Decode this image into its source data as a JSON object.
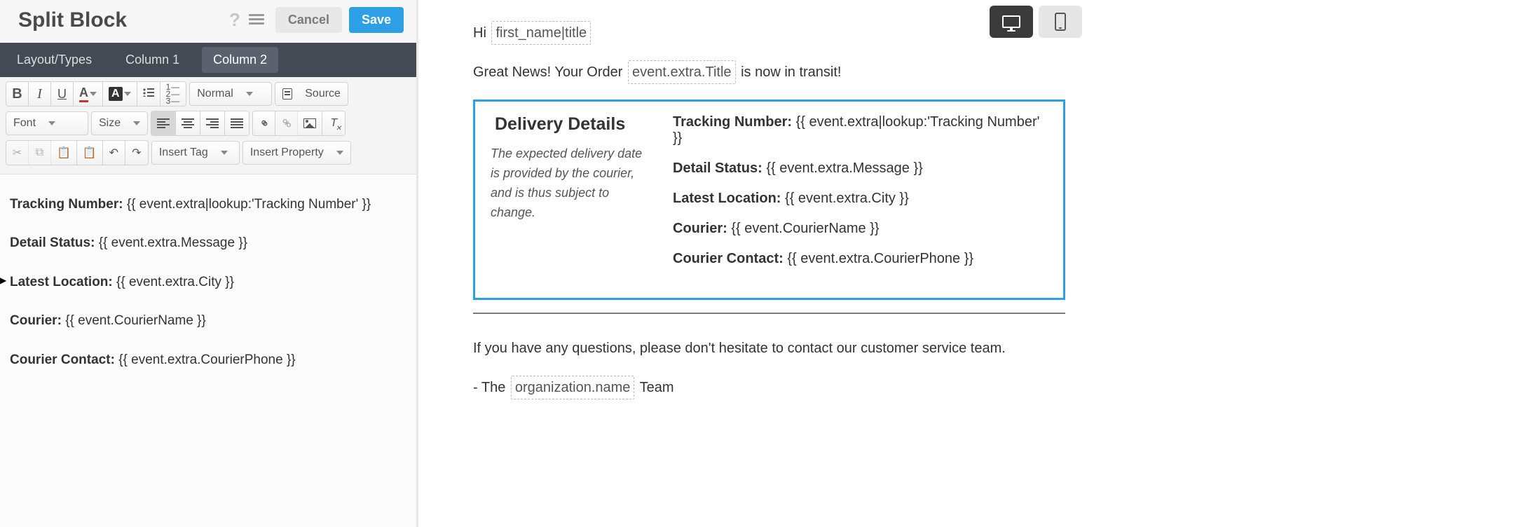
{
  "editor": {
    "title": "Split Block",
    "buttons": {
      "cancel": "Cancel",
      "save": "Save"
    },
    "tabs": {
      "layout": "Layout/Types",
      "col1": "Column 1",
      "col2": "Column 2"
    },
    "active_tab": "col2",
    "toolbar": {
      "bold": "B",
      "italic": "I",
      "underline": "U",
      "format_select": "Normal",
      "source": "Source",
      "font_select": "Font",
      "size_select": "Size",
      "insert_tag": "Insert Tag",
      "insert_property": "Insert Property"
    },
    "content": {
      "rows": [
        {
          "label": "Tracking Number:",
          "value": "{{ event.extra|lookup:'Tracking Number' }}"
        },
        {
          "label": "Detail Status:",
          "value": "{{ event.extra.Message }}"
        },
        {
          "label": "Latest Location:",
          "value": "{{ event.extra.City }}",
          "cursor": true
        },
        {
          "label": "Courier:",
          "value": "{{ event.CourierName }}"
        },
        {
          "label": "Courier Contact:",
          "value": "{{ event.extra.CourierPhone }}"
        }
      ]
    }
  },
  "preview": {
    "greeting_prefix": "Hi ",
    "greeting_var": "first_name|title",
    "line2_prefix": "Great News! Your Order ",
    "line2_var": "event.extra.Title",
    "line2_suffix": " is now in transit!",
    "box": {
      "heading": "Delivery Details",
      "note": "The expected delivery date is provided by the courier, and is thus subject to change.",
      "rows": [
        {
          "label": "Tracking Number:",
          "value": "{{ event.extra|lookup:'Tracking Number' }}"
        },
        {
          "label": "Detail Status:",
          "value": "{{ event.extra.Message }}"
        },
        {
          "label": "Latest Location:",
          "value": "{{ event.extra.City }}"
        },
        {
          "label": "Courier:",
          "value": "{{ event.CourierName }}"
        },
        {
          "label": "Courier Contact:",
          "value": "{{ event.extra.CourierPhone }}"
        }
      ]
    },
    "footer_q": "If you have any questions, please don't hesitate to contact our customer service team.",
    "sig_prefix": "- The ",
    "sig_var": "organization.name",
    "sig_suffix": " Team"
  },
  "colors": {
    "accent": "#2c9fe5",
    "tabbar": "#434a54"
  }
}
